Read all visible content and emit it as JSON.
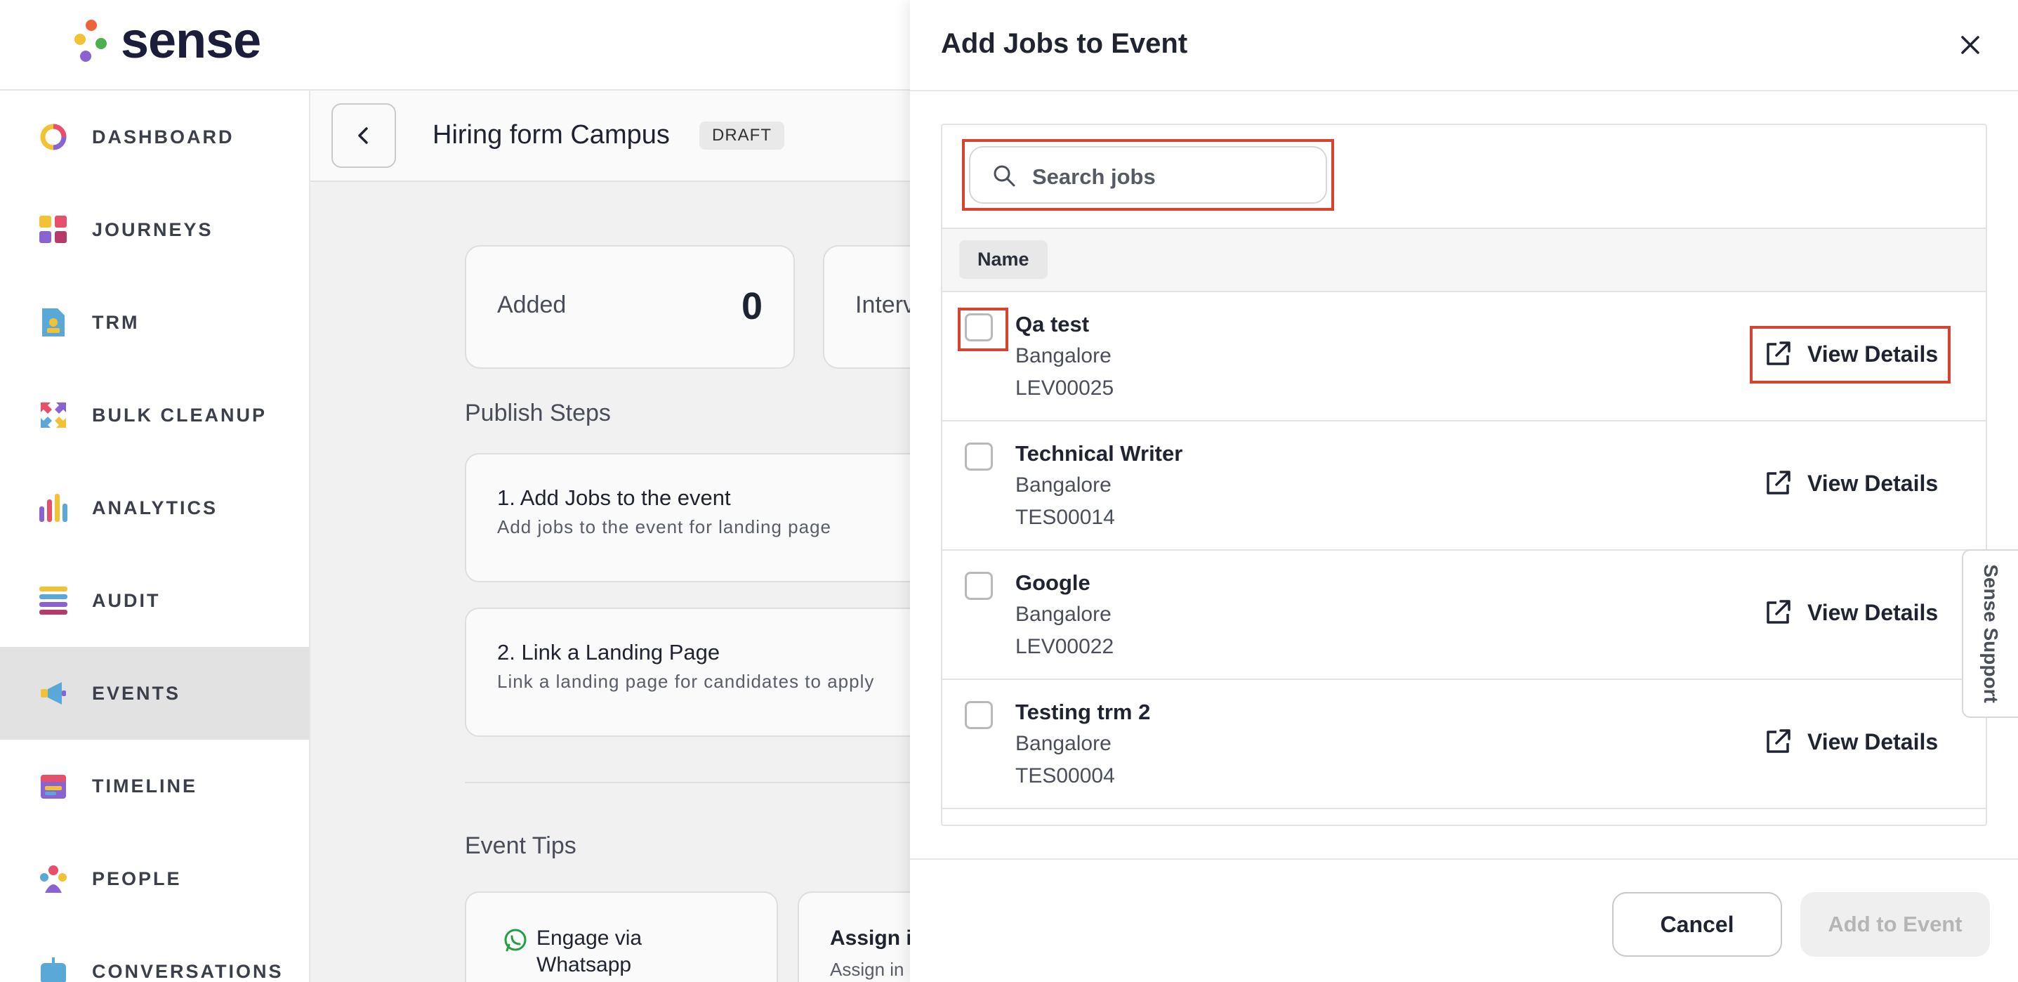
{
  "brand": {
    "name": "sense"
  },
  "sidebar": {
    "items": [
      {
        "label": "DASHBOARD",
        "icon": "dashboard-ring-icon"
      },
      {
        "label": "JOURNEYS",
        "icon": "journeys-grid-icon"
      },
      {
        "label": "TRM",
        "icon": "trm-document-icon"
      },
      {
        "label": "BULK CLEANUP",
        "icon": "bulk-cleanup-arrows-icon"
      },
      {
        "label": "ANALYTICS",
        "icon": "analytics-bars-icon"
      },
      {
        "label": "AUDIT",
        "icon": "audit-list-icon"
      },
      {
        "label": "EVENTS",
        "icon": "megaphone-icon",
        "active": true
      },
      {
        "label": "TIMELINE",
        "icon": "timeline-calendar-icon"
      },
      {
        "label": "PEOPLE",
        "icon": "people-icon"
      },
      {
        "label": "CONVERSATIONS",
        "icon": "conversations-bot-icon"
      }
    ]
  },
  "page": {
    "title": "Hiring form Campus",
    "status_badge": "DRAFT",
    "stats": [
      {
        "label": "Added",
        "value": "0"
      },
      {
        "label": "Interv"
      }
    ],
    "publish_steps_title": "Publish Steps",
    "steps": [
      {
        "title": "1. Add Jobs to the event",
        "subtitle": "Add jobs to the event for landing page"
      },
      {
        "title": "2. Link a Landing Page",
        "subtitle": "Link a landing page for candidates to apply"
      }
    ],
    "event_tips_title": "Event Tips",
    "tips": [
      {
        "title": "Engage via Whatsapp",
        "icon": "whatsapp-icon"
      },
      {
        "title": "Assign in",
        "subtitle": "Assign in"
      }
    ]
  },
  "modal": {
    "title": "Add Jobs to Event",
    "search": {
      "placeholder": "Search jobs"
    },
    "column_header": "Name",
    "jobs": [
      {
        "name": "Qa test",
        "location": "Bangalore",
        "code": "LEV00025",
        "action": "View Details"
      },
      {
        "name": "Technical Writer",
        "location": "Bangalore",
        "code": "TES00014",
        "action": "View Details"
      },
      {
        "name": "Google",
        "location": "Bangalore",
        "code": "LEV00022",
        "action": "View Details"
      },
      {
        "name": "Testing trm 2",
        "location": "Bangalore",
        "code": "TES00004",
        "action": "View Details"
      }
    ],
    "cancel_label": "Cancel",
    "add_label": "Add to Event"
  },
  "support": {
    "label": "Sense Support"
  },
  "colors": {
    "highlight": "#d8432f",
    "active_nav": "#e2e2e2",
    "brand_text": "#1c1d3a"
  }
}
